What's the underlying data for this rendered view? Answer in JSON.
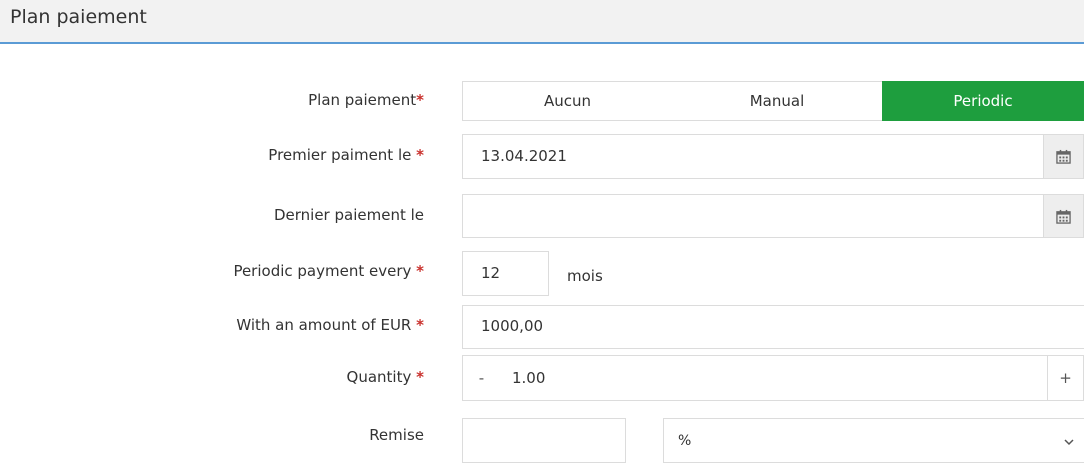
{
  "header": {
    "title": "Plan paiement"
  },
  "form": {
    "plan": {
      "label": "Plan paiement",
      "required": "*",
      "options": [
        "Aucun",
        "Manual",
        "Periodic"
      ],
      "selected": "Periodic"
    },
    "first_payment": {
      "label": "Premier paiment le",
      "required": "*",
      "value": "13.04.2021"
    },
    "last_payment": {
      "label": "Dernier paiement le",
      "value": ""
    },
    "periodic": {
      "label": "Periodic payment every",
      "required": "*",
      "value": "12",
      "unit": "mois"
    },
    "amount": {
      "label": "With an amount of EUR",
      "required": "*",
      "value": "1000,00"
    },
    "quantity": {
      "label": "Quantity",
      "required": "*",
      "value": "1.00",
      "minus": "-",
      "plus": "+"
    },
    "discount": {
      "label": "Remise",
      "value": "",
      "type_value": "%"
    }
  },
  "colors": {
    "selected": "#1e9e3e",
    "required": "#c9302c",
    "accent": "#5b9bd5"
  }
}
